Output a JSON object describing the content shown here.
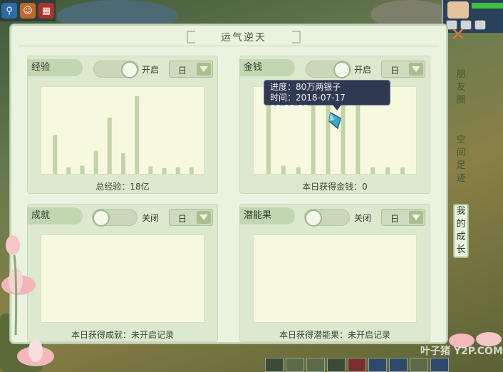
{
  "window": {
    "title": "运气逆天",
    "close_icon": "close-icon"
  },
  "hud": {
    "icons": [
      "search-icon",
      "character-icon",
      "calendar-icon"
    ]
  },
  "sections": {
    "exp": {
      "label": "经验",
      "toggle_state": "on",
      "toggle_label": "开启",
      "period": "日",
      "footer": "总经验：18亿",
      "bars": [
        4.7,
        0.8,
        1.0,
        2.8,
        6.8,
        2.5,
        9.4,
        0.9,
        0.7,
        0.8,
        0.8
      ]
    },
    "money": {
      "label": "金钱",
      "toggle_state": "on",
      "toggle_label": "开启",
      "period": "日",
      "footer": "本日获得金钱：0",
      "bars": [
        9.6,
        1.0,
        0.8,
        9.6,
        9.6,
        9.6,
        9.6,
        0.8,
        0.8,
        0.8
      ]
    },
    "achievement": {
      "label": "成就",
      "toggle_state": "off",
      "toggle_label": "关闭",
      "period": "日",
      "footer": "本日获得成就：未开启记录"
    },
    "potential": {
      "label": "潜能果",
      "toggle_state": "off",
      "toggle_label": "关闭",
      "period": "日",
      "footer": "本日获得潜能果：未开启记录"
    }
  },
  "tooltip": {
    "progress": "进度：80万两银子",
    "time": "时间：2018-07-17 00:00:00"
  },
  "side_tabs": [
    {
      "label": "朋友圈",
      "active": false
    },
    {
      "label": "空间足迹",
      "active": false
    },
    {
      "label": "我的成长",
      "active": true
    }
  ],
  "watermark": "叶子猪 Y2P.COM"
}
